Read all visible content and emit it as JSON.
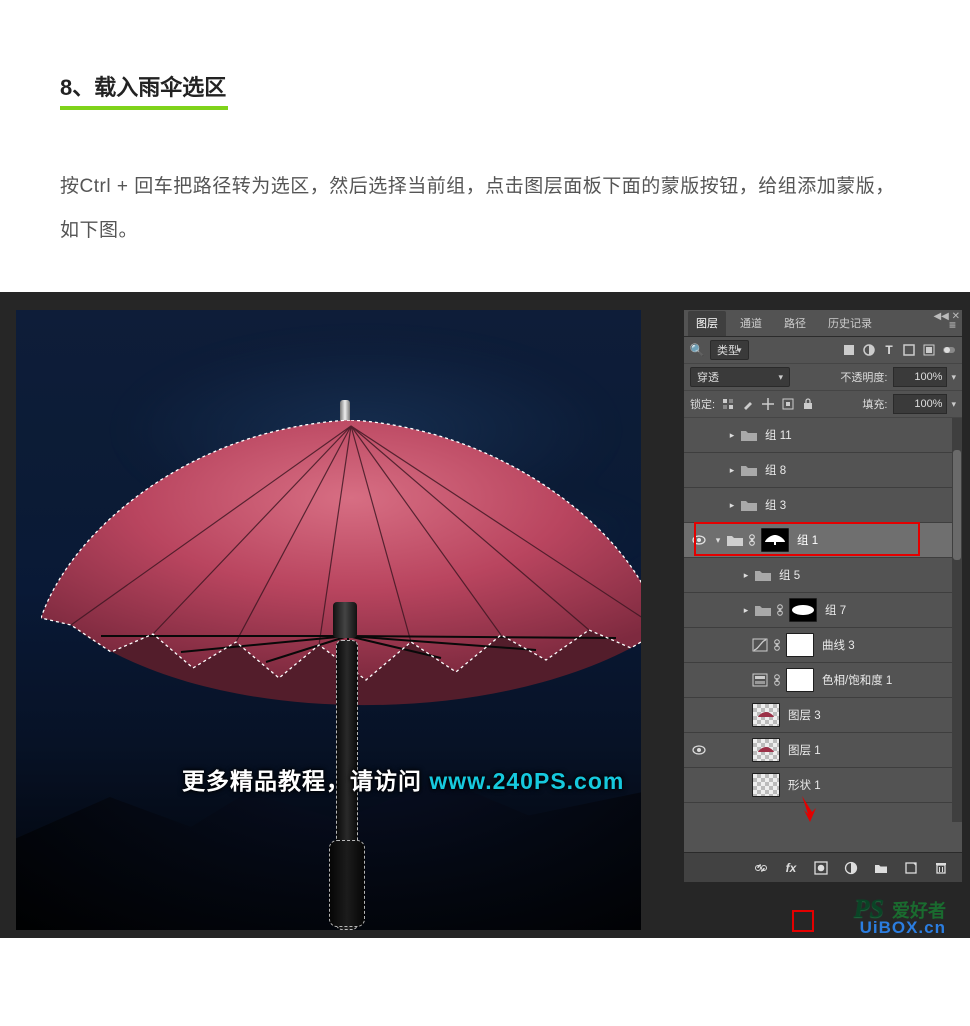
{
  "doc": {
    "step_title": "8、载入雨伞选区",
    "body_text": "按Ctrl + 回车把路径转为选区，然后选择当前组，点击图层面板下面的蒙版按钮，给组添加蒙版，如下图。"
  },
  "canvas": {
    "watermark_cn": "更多精品教程，请访问 ",
    "watermark_url": "www.240PS.com"
  },
  "panel": {
    "tabs": {
      "layers": "图层",
      "channels": "通道",
      "paths": "路径",
      "history": "历史记录"
    },
    "filter_label": "类型",
    "blend_mode": "穿透",
    "opacity_label": "不透明度:",
    "opacity_value": "100%",
    "lock_label": "锁定:",
    "fill_label": "填充:",
    "fill_value": "100%",
    "layers": {
      "group11": "组 11",
      "group8": "组 8",
      "group3": "组 3",
      "group1": "组 1",
      "group5": "组 5",
      "group7": "组 7",
      "curves3": "曲线 3",
      "huesat1": "色相/饱和度 1",
      "layer3": "图层 3",
      "layer1": "图层 1",
      "shape1": "形状 1"
    },
    "footer": {
      "link": "link-icon",
      "fx": "fx",
      "mask": "add-mask-icon",
      "adjust": "adjustment-icon",
      "newgroup": "new-group-icon",
      "newlayer": "new-layer-icon",
      "trash": "trash-icon"
    }
  },
  "site_wm": {
    "ps": "PS",
    "zh": "爱好者",
    "domain": "UiBOX.cn"
  }
}
